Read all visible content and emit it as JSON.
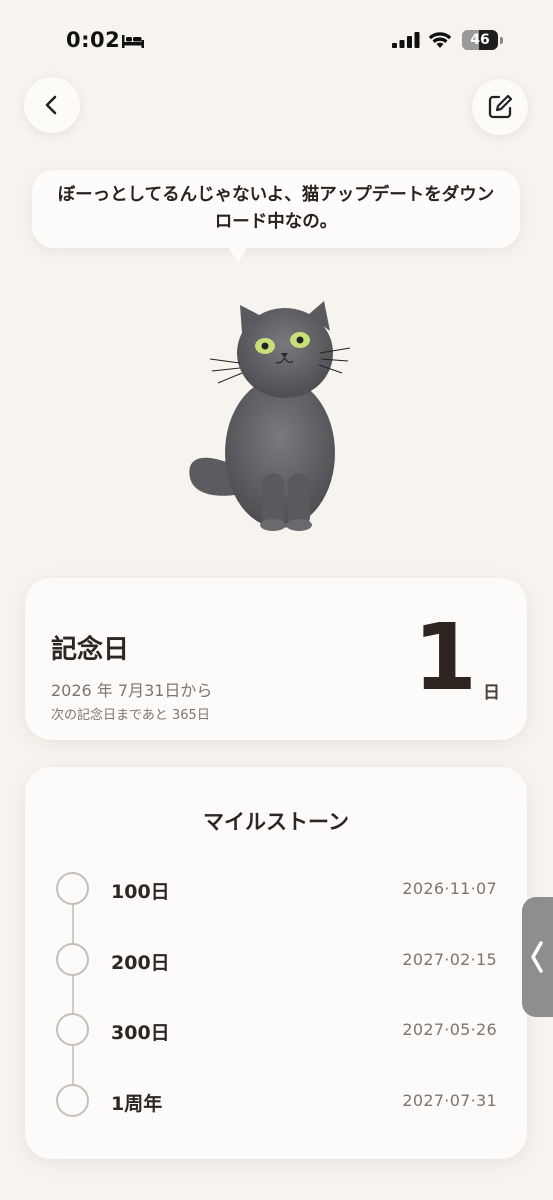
{
  "status_bar": {
    "time": "0:02",
    "battery": "46",
    "battery_level": 0.46,
    "icons": [
      "bed-icon",
      "signal-icon",
      "wifi-icon",
      "battery-icon"
    ]
  },
  "header": {
    "back_icon": "chevron-left-icon",
    "edit_icon": "edit-icon"
  },
  "bubble": {
    "text": "ぼーっとしてるんじゃないよ、猫アップデートをダウンロード中なの。"
  },
  "anniversary": {
    "title": "記念日",
    "since": "2026 年 7月31日から",
    "next": "次の記念日まであと 365日",
    "count": "1",
    "unit": "日"
  },
  "milestones": {
    "title": "マイルストーン",
    "items": [
      {
        "label": "100日",
        "date": "2026·11·07"
      },
      {
        "label": "200日",
        "date": "2027·02·15"
      },
      {
        "label": "300日",
        "date": "2027·05·26"
      },
      {
        "label": "1周年",
        "date": "2027·07·31"
      }
    ]
  },
  "colors": {
    "background": "#f7f3ee",
    "card": "#fcfbf9",
    "text_primary": "#2e2624",
    "text_secondary": "#7e7570",
    "cat_fur": "#5e5e62",
    "cat_eyes": "#c8e07a"
  }
}
